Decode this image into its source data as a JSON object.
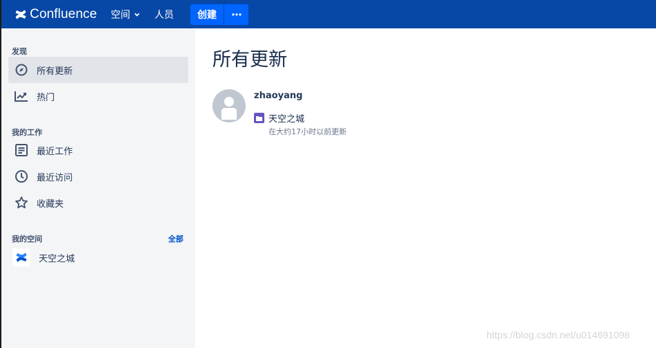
{
  "topnav": {
    "logo_text": "Confluence",
    "spaces_label": "空间",
    "people_label": "人员",
    "create_label": "创建",
    "more_icon": "ellipsis-icon",
    "bg_color": "#0747a6",
    "button_color": "#0065ff"
  },
  "sidebar": {
    "discover_title": "发现",
    "discover_items": [
      {
        "label": "所有更新",
        "icon": "compass-icon",
        "active": true
      },
      {
        "label": "热门",
        "icon": "trending-icon",
        "active": false
      }
    ],
    "mywork_title": "我的工作",
    "mywork_items": [
      {
        "label": "最近工作",
        "icon": "document-icon"
      },
      {
        "label": "最近访问",
        "icon": "clock-icon"
      },
      {
        "label": "收藏夹",
        "icon": "star-icon"
      }
    ],
    "myspaces_title": "我的空间",
    "all_label": "全部",
    "spaces": [
      {
        "label": "天空之城",
        "icon": "confluence-space-icon"
      }
    ]
  },
  "main": {
    "title": "所有更新",
    "updates": [
      {
        "user": "zhaoyang",
        "title": "天空之城",
        "time": "在大约17小时以前更新",
        "icon": "folder-icon",
        "icon_color": "#6554c0"
      }
    ]
  },
  "watermark": "https://blog.csdn.net/u014691098"
}
